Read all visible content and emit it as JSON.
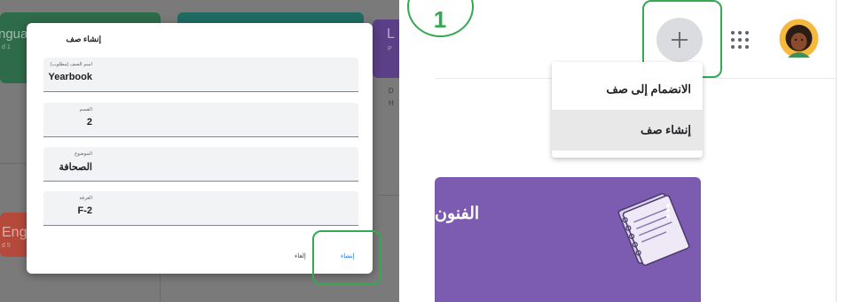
{
  "background": {
    "card_top_left_text": "ngua",
    "card_top_left_sub": "d 1",
    "card_top_right_text": "L",
    "card_top_right_sub": "P",
    "card_mid_right_text1": "D",
    "card_mid_right_text2": "H",
    "card_bottom_left_text": "Eng",
    "card_bottom_left_sub": "d 5"
  },
  "dialog": {
    "title": "إنشاء صف",
    "fields": [
      {
        "label": "اسم الصف (مطلوب)",
        "value": "Yearbook"
      },
      {
        "label": "القسم",
        "value": "2"
      },
      {
        "label": "الموضوع",
        "value": "الصحافة"
      },
      {
        "label": "الغرفة",
        "value": "F-2"
      }
    ],
    "cancel_label": "إلغاء",
    "create_label": "إنشاء"
  },
  "step": {
    "number": "1"
  },
  "topbar": {
    "add_icon": "plus-icon",
    "apps_icon": "apps-grid-icon",
    "avatar_icon": "user-avatar"
  },
  "menu": {
    "join_label": "الانضمام إلى صف",
    "create_label": "إنشاء صف"
  },
  "class_card": {
    "name": "الفنون",
    "color": "#7c5cb0"
  },
  "colors": {
    "highlight": "#34a853",
    "link": "#1a73e8"
  }
}
